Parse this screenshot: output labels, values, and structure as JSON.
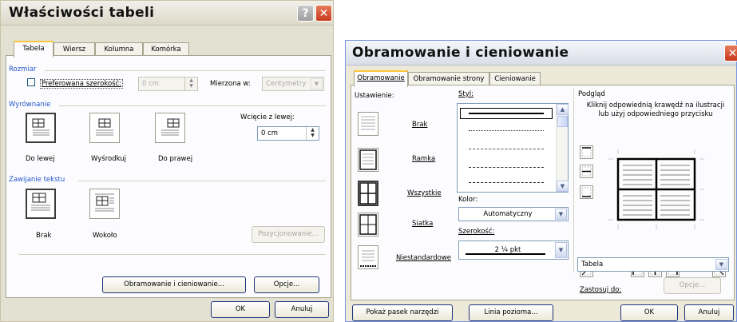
{
  "win1": {
    "title": "Właściwości tabeli",
    "tabs": [
      "Tabela",
      "Wiersz",
      "Kolumna",
      "Komórka"
    ],
    "rozmiar": {
      "group_label": "Rozmiar",
      "pref_width_label": "Preferowana szerokość:",
      "pref_width_value": "0 cm",
      "measure_label": "Mierzona w:",
      "measure_value": "Centymetry"
    },
    "align": {
      "group_label": "Wyrównanie",
      "options": [
        "Do lewej",
        "Wyśrodkuj",
        "Do prawej"
      ],
      "indent_label": "Wcięcie z lewej:",
      "indent_value": "0 cm"
    },
    "wrap": {
      "group_label": "Zawijanie tekstu",
      "options": [
        "Brak",
        "Wokoło"
      ],
      "position_button": "Pozycjonowanie..."
    },
    "borders_button": "Obramowanie i cieniowanie...",
    "options_button": "Opcje...",
    "ok_button": "OK",
    "cancel_button": "Anuluj"
  },
  "win2": {
    "title": "Obramowanie i cieniowanie",
    "tabs": [
      "Obramowanie",
      "Obramowanie strony",
      "Cieniowanie"
    ],
    "setting_label": "Ustawienie:",
    "settings": [
      "Brak",
      "Ramka",
      "Wszystkie",
      "Siatka",
      "Niestandardowe"
    ],
    "style_label": "Styl:",
    "color_label": "Kolor:",
    "color_value": "Automatyczny",
    "width_label": "Szerokość:",
    "width_value": "2 ¼ pkt",
    "preview_label": "Podgląd",
    "preview_hint": "Kliknij odpowiednią krawędź na ilustracji lub użyj odpowiedniego przycisku",
    "apply_label": "Zastosuj do:",
    "apply_value": "Tabela",
    "options_button": "Opcje...",
    "toolbar_button": "Pokaż pasek narzędzi",
    "hline_button": "Linia pozioma...",
    "ok_button": "OK",
    "cancel_button": "Anuluj"
  }
}
